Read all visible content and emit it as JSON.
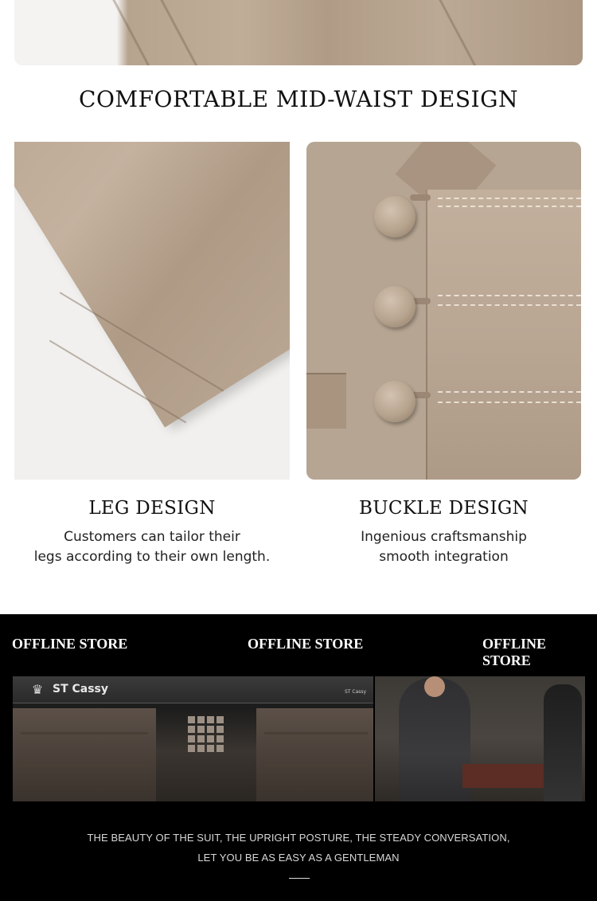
{
  "heading": "COMFORTABLE MID-WAIST DESIGN",
  "features": [
    {
      "title": "LEG DESIGN",
      "lines": [
        "Customers can tailor their",
        "legs according to their own length."
      ]
    },
    {
      "title": "BUCKLE DESIGN",
      "lines": [
        "Ingenious craftsmanship",
        "smooth integration"
      ]
    }
  ],
  "store": {
    "labels": [
      "OFFLINE STORE",
      "OFFLINE STORE",
      "OFFLINE STORE"
    ],
    "brand_logo": "ST Cassy",
    "brand_logo_small": "ST Cassy",
    "quote_lines": [
      "THE BEAUTY OF THE SUIT, THE UPRIGHT POSTURE, THE STEADY CONVERSATION,",
      "LET YOU BE AS EASY AS A GENTLEMAN"
    ]
  },
  "colors": {
    "fabric": "#b9a693",
    "store_background": "#000000",
    "heading_text": "#111111"
  }
}
